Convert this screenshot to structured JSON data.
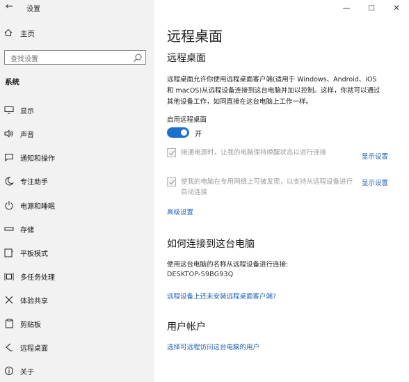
{
  "window": {
    "title": "设置",
    "controls": {
      "minimize": "—",
      "maximize": "☐",
      "close": "✕"
    }
  },
  "sidebar": {
    "home_label": "主页",
    "search_placeholder": "查找设置",
    "section": "系统",
    "items": [
      {
        "label": "显示",
        "icon": "monitor-icon"
      },
      {
        "label": "声音",
        "icon": "speaker-icon"
      },
      {
        "label": "通知和操作",
        "icon": "notification-icon"
      },
      {
        "label": "专注助手",
        "icon": "moon-icon"
      },
      {
        "label": "电源和睡眠",
        "icon": "power-icon"
      },
      {
        "label": "存储",
        "icon": "storage-icon"
      },
      {
        "label": "平板模式",
        "icon": "tablet-icon"
      },
      {
        "label": "多任务处理",
        "icon": "multitask-icon"
      },
      {
        "label": "体验共享",
        "icon": "share-icon"
      },
      {
        "label": "剪贴板",
        "icon": "clipboard-icon"
      },
      {
        "label": "远程桌面",
        "icon": "remote-desktop-icon"
      },
      {
        "label": "关于",
        "icon": "info-icon"
      }
    ]
  },
  "main": {
    "page_title": "远程桌面",
    "section_title": "远程桌面",
    "description_line1": "远程桌面允许你使用远程桌面客户端(适用于 Windows、Android、iOS",
    "description_line2": "和 macOS)从远程设备连接到这台电脑并加以控制。这样，你就可以通过",
    "description_line3": "其他设备工作，如同直接在这台电脑上工作一样。",
    "enable_label": "启用远程桌面",
    "toggle_state": "开",
    "option1_text": "接通电源时，让我的电脑保持唤醒状态以进行连接",
    "option1_link": "显示设置",
    "option2_line1": "使我的电脑在专用网络上可被发现，以支持从远程设备进行",
    "option2_line2": "自动连接",
    "option2_link": "显示设置",
    "advanced_link": "高级设置",
    "connect_title": "如何连接到这台电脑",
    "connect_desc": "使用这台电脑的名称从远程设备进行连接:",
    "pc_name": "DESKTOP-S9BG93Q",
    "client_link": "远程设备上还未安装远程桌面客户端?",
    "accounts_title": "用户帐户",
    "accounts_link": "选择可远程访问这台电脑的用户"
  }
}
